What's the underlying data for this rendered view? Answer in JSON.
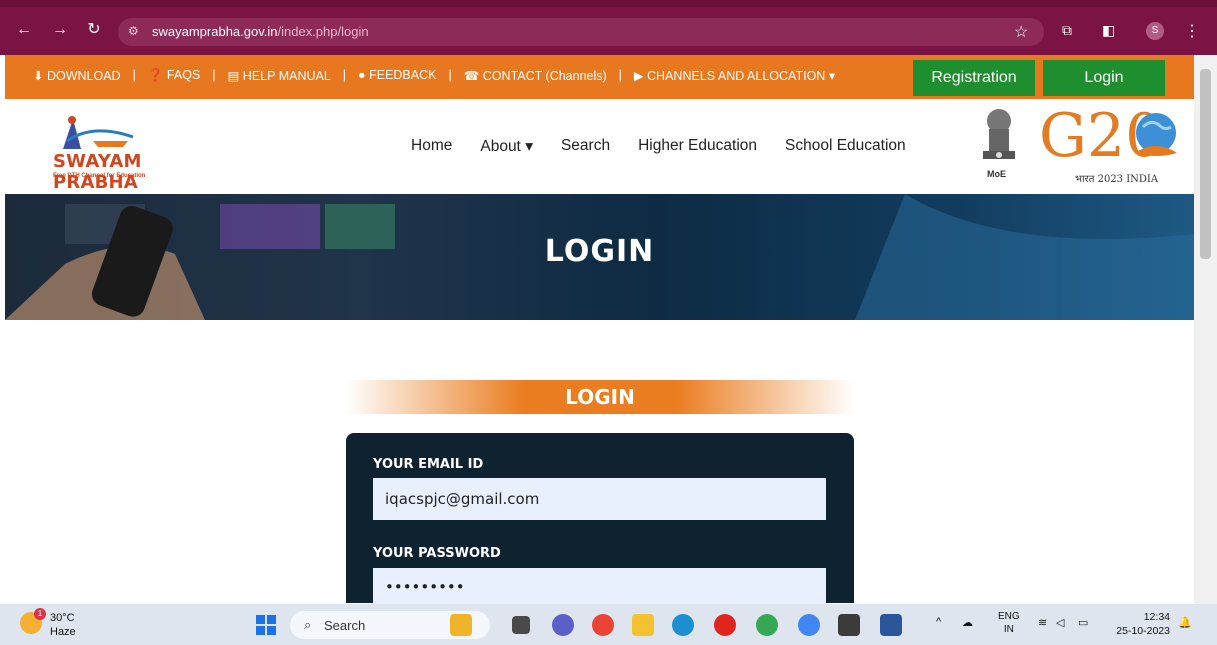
{
  "browser": {
    "url_domain": "swayamprabha.gov.in",
    "url_path": "/index.php/login",
    "profile_initial": "S"
  },
  "topbar": {
    "links": [
      {
        "icon": "download-icon",
        "glyph": "⬇",
        "label": "DOWNLOAD"
      },
      {
        "icon": "question-icon",
        "glyph": "❓",
        "label": "FAQS"
      },
      {
        "icon": "book-icon",
        "glyph": "▤",
        "label": "HELP MANUAL"
      },
      {
        "icon": "chat-icon",
        "glyph": "●",
        "label": "FEEDBACK"
      },
      {
        "icon": "phone-icon",
        "glyph": "☎",
        "label": "CONTACT (Channels)"
      },
      {
        "icon": "play-icon",
        "glyph": "▶",
        "label": "CHANNELS AND ALLOCATION"
      }
    ],
    "registration_label": "Registration",
    "login_label": "Login"
  },
  "header": {
    "brand": "SWAYAM PRABHA",
    "tagline": "Free DTH Channel for Education",
    "nav": [
      "Home",
      "About",
      "Search",
      "Higher Education",
      "School Education"
    ],
    "emblem_caption": "MoE",
    "g20_text": "G20",
    "g20_sub": "भारत 2023 INDIA"
  },
  "hero": {
    "title": "LOGIN"
  },
  "login": {
    "heading": "LOGIN",
    "email_label": "YOUR EMAIL ID",
    "email_value": "iqacspjc@gmail.com",
    "password_label": "YOUR PASSWORD",
    "password_value": "•••••••••"
  },
  "taskbar": {
    "weather_badge": "1",
    "temperature": "30°C",
    "condition": "Haze",
    "search_label": "Search",
    "language_top": "ENG",
    "language_bottom": "IN",
    "time": "12:34",
    "date": "25-10-2023"
  },
  "colors": {
    "chrome": "#7b1445",
    "topbar": "#e8781f",
    "button_green": "#1f8e2f",
    "form_bg": "#0f2230"
  }
}
